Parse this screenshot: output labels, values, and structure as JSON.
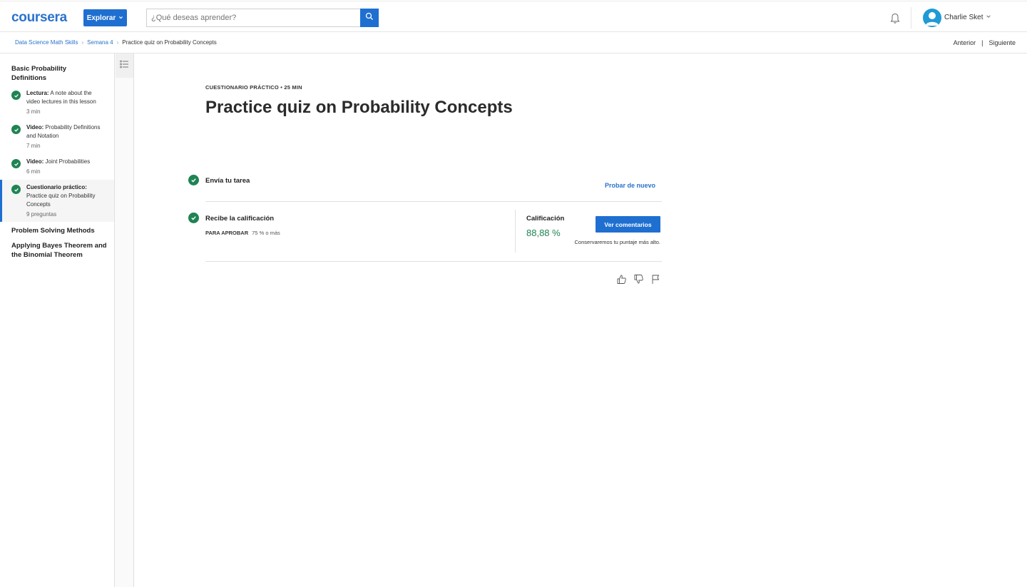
{
  "header": {
    "logo": "coursera",
    "explore_label": "Explorar",
    "search_placeholder": "¿Qué deseas aprender?",
    "user_name": "Charlie Sket"
  },
  "breadcrumb": {
    "items": [
      "Data Science Math Skills",
      "Semana 4",
      "Practice quiz on Probability Concepts"
    ],
    "prev": "Anterior",
    "next": "Siguiente"
  },
  "sidebar": {
    "sections": [
      {
        "title": "Basic Probability Definitions"
      },
      {
        "title": "Problem Solving Methods"
      },
      {
        "title": "Applying Bayes Theorem and the Binomial Theorem"
      }
    ],
    "items": [
      {
        "kind": "Lectura:",
        "label": " A note about the video lectures in this lesson",
        "meta": "3 min"
      },
      {
        "kind": "Video:",
        "label": " Probability Definitions and Notation",
        "meta": "7 min"
      },
      {
        "kind": "Video:",
        "label": " Joint Probabilities",
        "meta": "6 min"
      },
      {
        "kind": "Cuestionario práctico:",
        "label": " Practice quiz on Probability Concepts",
        "meta": "9 preguntas"
      }
    ]
  },
  "main": {
    "kicker": "CUESTIONARIO PRÁCTICO • 25 MIN",
    "title": "Practice quiz on Probability Concepts",
    "step1_label": "Envía tu tarea",
    "retry_label": "Probar de nuevo",
    "step2_label": "Recibe la calificación",
    "pass_label": "PARA APROBAR",
    "pass_value": "75 % o más",
    "grade_label": "Calificación",
    "grade_value": "88,88 %",
    "feedback_button": "Ver comentarios",
    "keep_note": "Conservaremos tu puntaje más alto."
  },
  "colors": {
    "brand_blue": "#1f6fd1",
    "success_green": "#1f8354"
  }
}
